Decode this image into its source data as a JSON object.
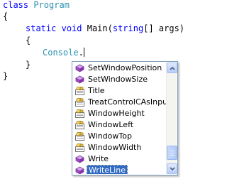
{
  "editor": {
    "line1_kw": "class",
    "line1_name": "Program",
    "line2": "{",
    "line3_static": "static",
    "line3_void": "void",
    "line3_main": "Main(",
    "line3_string": "string",
    "line3_args": "[] args)",
    "line4": "{",
    "line5_console": "Console",
    "line5_dot": ".",
    "line6": "}",
    "line7": "}"
  },
  "intellisense": {
    "items": [
      {
        "label": "SetWindowPosition",
        "icon": "method-icon"
      },
      {
        "label": "SetWindowSize",
        "icon": "method-icon"
      },
      {
        "label": "Title",
        "icon": "property-icon"
      },
      {
        "label": "TreatControlCAsInput",
        "icon": "property-icon"
      },
      {
        "label": "WindowHeight",
        "icon": "property-icon"
      },
      {
        "label": "WindowLeft",
        "icon": "property-icon"
      },
      {
        "label": "WindowTop",
        "icon": "property-icon"
      },
      {
        "label": "WindowWidth",
        "icon": "property-icon"
      },
      {
        "label": "Write",
        "icon": "method-icon"
      },
      {
        "label": "WriteLine",
        "icon": "method-icon",
        "selected": true
      }
    ],
    "scroll_position": 0.95
  },
  "colors": {
    "keyword": "#0000ff",
    "type": "#2b91af",
    "selection": "#316ac5",
    "method_icon": "#b35fd6",
    "property_icon": "#f5d76e"
  }
}
